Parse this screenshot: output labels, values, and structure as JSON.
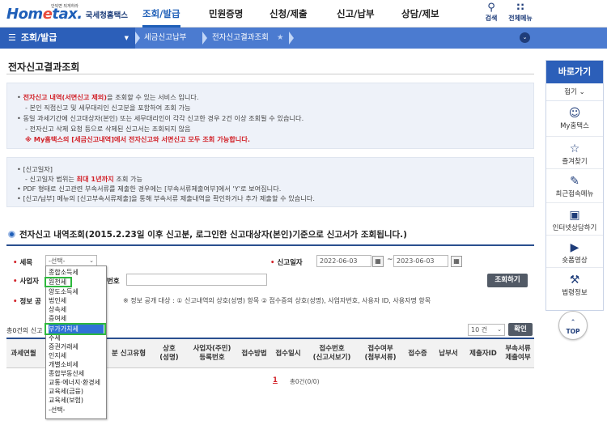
{
  "logo": {
    "brand": "Hometax",
    "kr": "국세청홈택스",
    "tiny": "안되면 되게하라"
  },
  "gnb": [
    "조회/발급",
    "민원증명",
    "신청/제출",
    "신고/납부",
    "상담/제보"
  ],
  "tools": [
    {
      "icon": "search-icon",
      "label": "검색"
    },
    {
      "icon": "grid-menu-icon",
      "label": "전체메뉴"
    }
  ],
  "subnav": {
    "menu": "조회/발급",
    "crumb1": "세금신고납부",
    "crumb2": "전자신고결과조회"
  },
  "page_title": "전자신고결과조회",
  "info1": {
    "l1a": "전자신고 내역(서면신고 제외)",
    "l1b": "을 조회할 수 있는 서비스 입니다.",
    "l2": "- 본인 직접신고 및 세무대리인 신고분을 포함하여 조회 가능",
    "l3": "동일 과세기간에 신고대상자(본인) 또는 세무대리인이 각각 신고한 경우 2건 이상 조회될 수 있습니다.",
    "l4": "- 전자신고 삭제 요청 등으로 삭제된 신고서는 조회되지 않음",
    "l5": "※ My홈택스의 [세금신고내역]에서 전자신고와 서면신고 모두 조회 가능합니다."
  },
  "info2": {
    "l1": "[신고일자]",
    "l2a": "- 신고일자 범위는 ",
    "l2b": "최대 1년까지",
    "l2c": " 조회 가능",
    "l3": "PDF 형태로 신고관련 부속서류를 제출한 경우에는 [부속서류제출여부]에서 'Y'로 보여집니다.",
    "l4": "[신고/납부] 메뉴의 [신고부속서류제출]을 통해 부속서류 제출내역을 확인하거나 추가 제출할 수 있습니다."
  },
  "section_heading": "전자신고 내역조회(2015.2.23일 이후 신고분, 로그인한  신고대상자(본인)기준으로  신고서가 조회됩니다.)",
  "form": {
    "tax_label": "세목",
    "tax_value": "-선택-",
    "date_label": "신고일자",
    "date_from": "2022-06-03",
    "date_to": "2023-06-03",
    "biz_label": "사업자",
    "biz_suffix": "번호",
    "info_label": "정보 공",
    "info_note": "※ 정보 공개 대상 : ① 신고내역의 상호(성명) 항목 ② 접수증의 상호(성명), 사업자번호, 사용자 ID, 사용자명 항목",
    "search_button": "조회하기"
  },
  "result": {
    "count_text": "총0건의 신고",
    "page_size": "10 건",
    "confirm_button": "확인",
    "page": "1",
    "page_total": "총0건(0/0)"
  },
  "table_headers": [
    "과세연월",
    "분 신고유형",
    "상호\n(성명)",
    "사업자(주민)\n등록번호",
    "접수방법",
    "접수일시",
    "접수번호\n(신고서보기)",
    "접수여부\n(첨부서류)",
    "접수증",
    "납부서",
    "제출자ID",
    "부속서류\n제출여부"
  ],
  "dropdown_options": [
    "종합소득세",
    "원천세",
    "양도소득세",
    "법인세",
    "상속세",
    "증여세",
    "부가가치세",
    "주세",
    "증권거래세",
    "인지세",
    "개별소비세",
    "종합부동산세",
    "교통·에너지·환경세",
    "교육세(금융)",
    "교육세(보험)",
    "-선택-"
  ],
  "dropdown_highlighted": [
    "원천세",
    "부가가치세"
  ],
  "quick_menu": {
    "title": "바로가기",
    "fold": "접기",
    "items": [
      {
        "icon": "person-icon",
        "label": "My홈택스"
      },
      {
        "icon": "star-icon",
        "label": "즐겨찾기"
      },
      {
        "icon": "recent-menu-icon",
        "label": "최근접속메뉴"
      },
      {
        "icon": "monitor-icon",
        "label": "인터넷상담하기"
      },
      {
        "icon": "play-icon",
        "label": "숏폼영상"
      },
      {
        "icon": "gavel-icon",
        "label": "법령정보"
      }
    ],
    "top": "TOP"
  },
  "colors": {
    "primary": "#2c5fb9",
    "accent_red": "#d2232a",
    "highlight": "#2db83d"
  }
}
